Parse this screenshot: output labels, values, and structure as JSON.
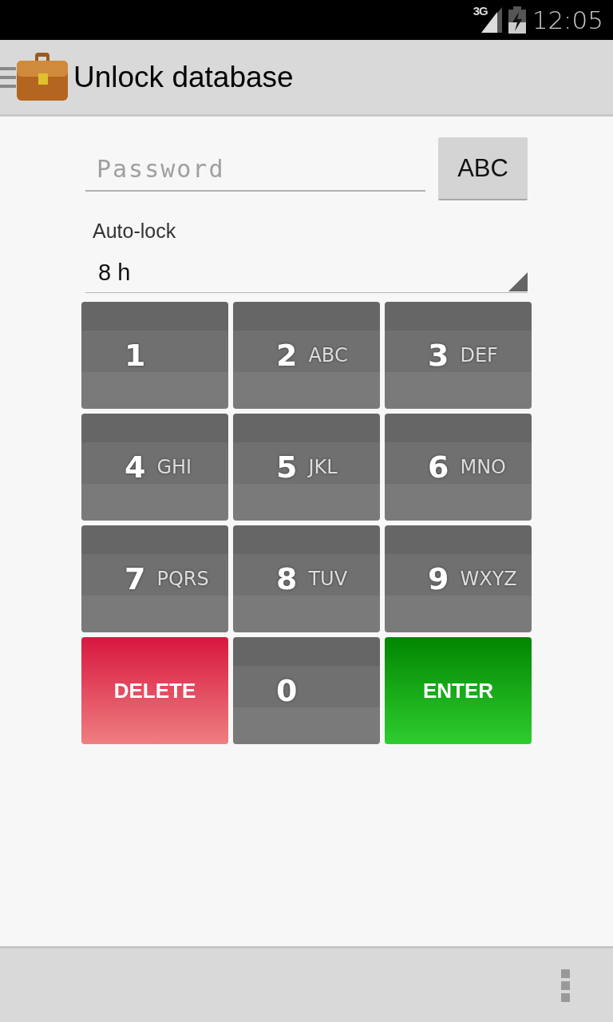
{
  "status_bar": {
    "network": "3G",
    "time": "12:05"
  },
  "action_bar": {
    "title": "Unlock database"
  },
  "password": {
    "placeholder": "Password"
  },
  "keyboard_toggle": {
    "label": "ABC"
  },
  "auto_lock": {
    "label": "Auto-lock",
    "value": "8 h"
  },
  "keypad": [
    {
      "kind": "digit",
      "digit": "1"
    },
    {
      "kind": "digit",
      "digit": "2",
      "letters": "ABC"
    },
    {
      "kind": "digit",
      "digit": "3",
      "letters": "DEF"
    },
    {
      "kind": "digit",
      "digit": "4",
      "letters": "GHI"
    },
    {
      "kind": "digit",
      "digit": "5",
      "letters": "JKL"
    },
    {
      "kind": "digit",
      "digit": "6",
      "letters": "MNO"
    },
    {
      "kind": "digit",
      "digit": "7",
      "letters": "PQRS"
    },
    {
      "kind": "digit",
      "digit": "8",
      "letters": "TUV"
    },
    {
      "kind": "digit",
      "digit": "9",
      "letters": "WXYZ"
    },
    {
      "kind": "delete",
      "label": "DELETE"
    },
    {
      "kind": "digit",
      "digit": "0"
    },
    {
      "kind": "enter",
      "label": "ENTER"
    }
  ]
}
